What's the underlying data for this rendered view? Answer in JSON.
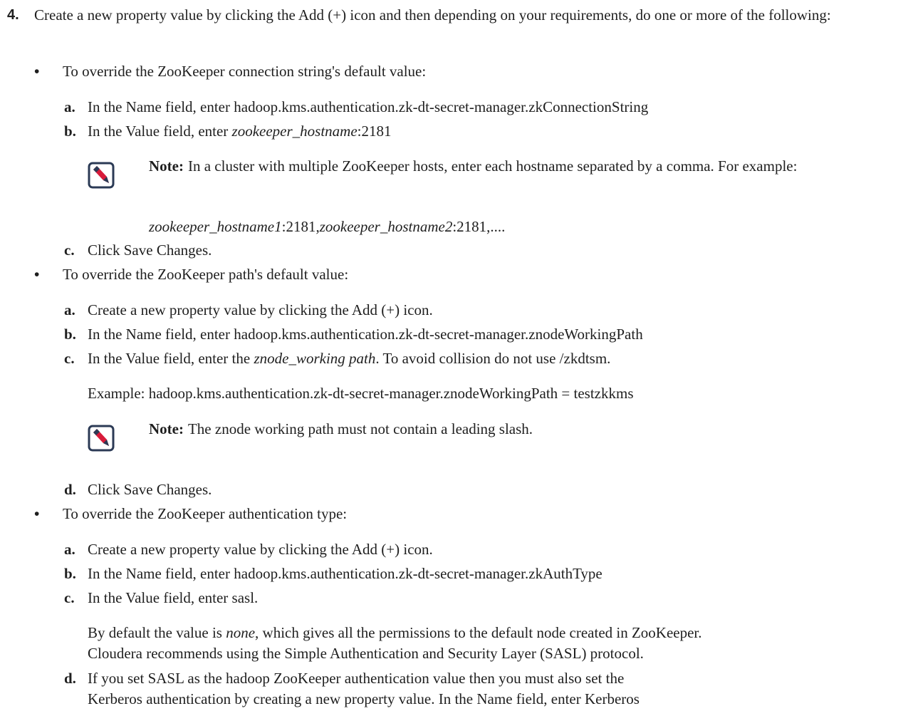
{
  "step": {
    "number": "4.",
    "text": "Create a new property value by clicking the Add (+) icon and then depending on your requirements, do one or more of the following:"
  },
  "bullets": [
    {
      "text": "To override the ZooKeeper connection string's default value:",
      "items": [
        {
          "letter": "a.",
          "text": "In the Name field, enter hadoop.kms.authentication.zk-dt-secret-manager.zkConnectionString"
        },
        {
          "letter": "b.",
          "prefix": "In the Value field, enter ",
          "em": "zookeeper_hostname",
          "suffix": ":2181"
        },
        {
          "letter": "c.",
          "text": "Click Save Changes."
        }
      ],
      "note": {
        "label": "Note:",
        "text": "In a cluster with multiple ZooKeeper hosts, enter each hostname separated by a comma. For example:",
        "example": {
          "em1": "zookeeper_hostname1",
          "mid": ":2181,",
          "em2": "zookeeper_hostname2",
          "end": ":2181,...."
        }
      }
    },
    {
      "text": "To override the ZooKeeper path's default value:",
      "items": [
        {
          "letter": "a.",
          "text": "Create a new property value by clicking the Add (+) icon."
        },
        {
          "letter": "b.",
          "text": "In the Name field, enter hadoop.kms.authentication.zk-dt-secret-manager.znodeWorkingPath"
        },
        {
          "letter": "c.",
          "prefix": "In the Value field, enter the ",
          "em": "znode_working path",
          "suffix": ". To avoid collision do not use /zkdtsm."
        },
        {
          "letter": "d.",
          "text": "Click Save Changes."
        }
      ],
      "example": "Example: hadoop.kms.authentication.zk-dt-secret-manager.znodeWorkingPath = testzkkms",
      "note": {
        "label": "Note:",
        "text": "The znode working path must not contain a leading slash."
      }
    },
    {
      "text": "To override the ZooKeeper authentication type:",
      "items": [
        {
          "letter": "a.",
          "text": "Create a new property value by clicking the Add (+) icon."
        },
        {
          "letter": "b.",
          "text": "In the Name field, enter hadoop.kms.authentication.zk-dt-secret-manager.zkAuthType"
        },
        {
          "letter": "c.",
          "text": "In the Value field, enter sasl."
        },
        {
          "letter": "d.",
          "line1": "If you set SASL as the hadoop ZooKeeper authentication value then you must also set the",
          "line2": "Kerberos authentication by creating a new property value. In the Name field, enter Kerberos"
        }
      ],
      "default": {
        "line1_prefix": "By default the value is ",
        "line1_em": "none",
        "line1_suffix": ", which gives all the permissions to the default node created in ZooKeeper.",
        "line2": "Cloudera recommends using the Simple Authentication and Security Layer (SASL) protocol."
      }
    }
  ],
  "icons": {
    "note": "note-pencil-icon"
  },
  "colors": {
    "text": "#1f1f1f",
    "icon_border": "#2b3a55",
    "icon_accent": "#d81b3a"
  }
}
